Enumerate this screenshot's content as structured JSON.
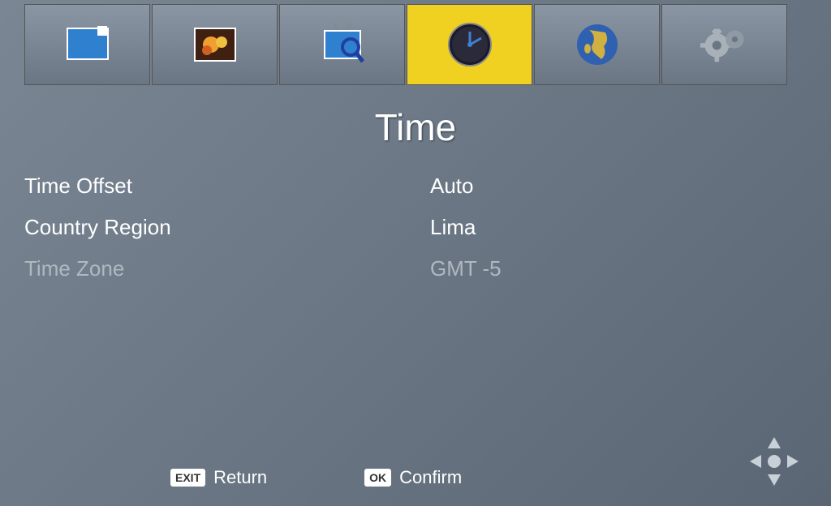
{
  "nav": {
    "items": [
      {
        "icon": "picture-icon",
        "selected": false
      },
      {
        "icon": "bokeh-icon",
        "selected": false
      },
      {
        "icon": "tv-search-icon",
        "selected": false
      },
      {
        "icon": "clock-icon",
        "selected": true
      },
      {
        "icon": "globe-icon",
        "selected": false
      },
      {
        "icon": "gear-icon",
        "selected": false
      }
    ]
  },
  "title": "Time",
  "settings": [
    {
      "label": "Time Offset",
      "value": "Auto",
      "dimmed": false
    },
    {
      "label": "Country Region",
      "value": "Lima",
      "dimmed": false
    },
    {
      "label": "Time Zone",
      "value": "GMT -5",
      "dimmed": true
    }
  ],
  "hints": {
    "exit_key": "EXIT",
    "exit_label": "Return",
    "ok_key": "OK",
    "ok_label": "Confirm"
  }
}
